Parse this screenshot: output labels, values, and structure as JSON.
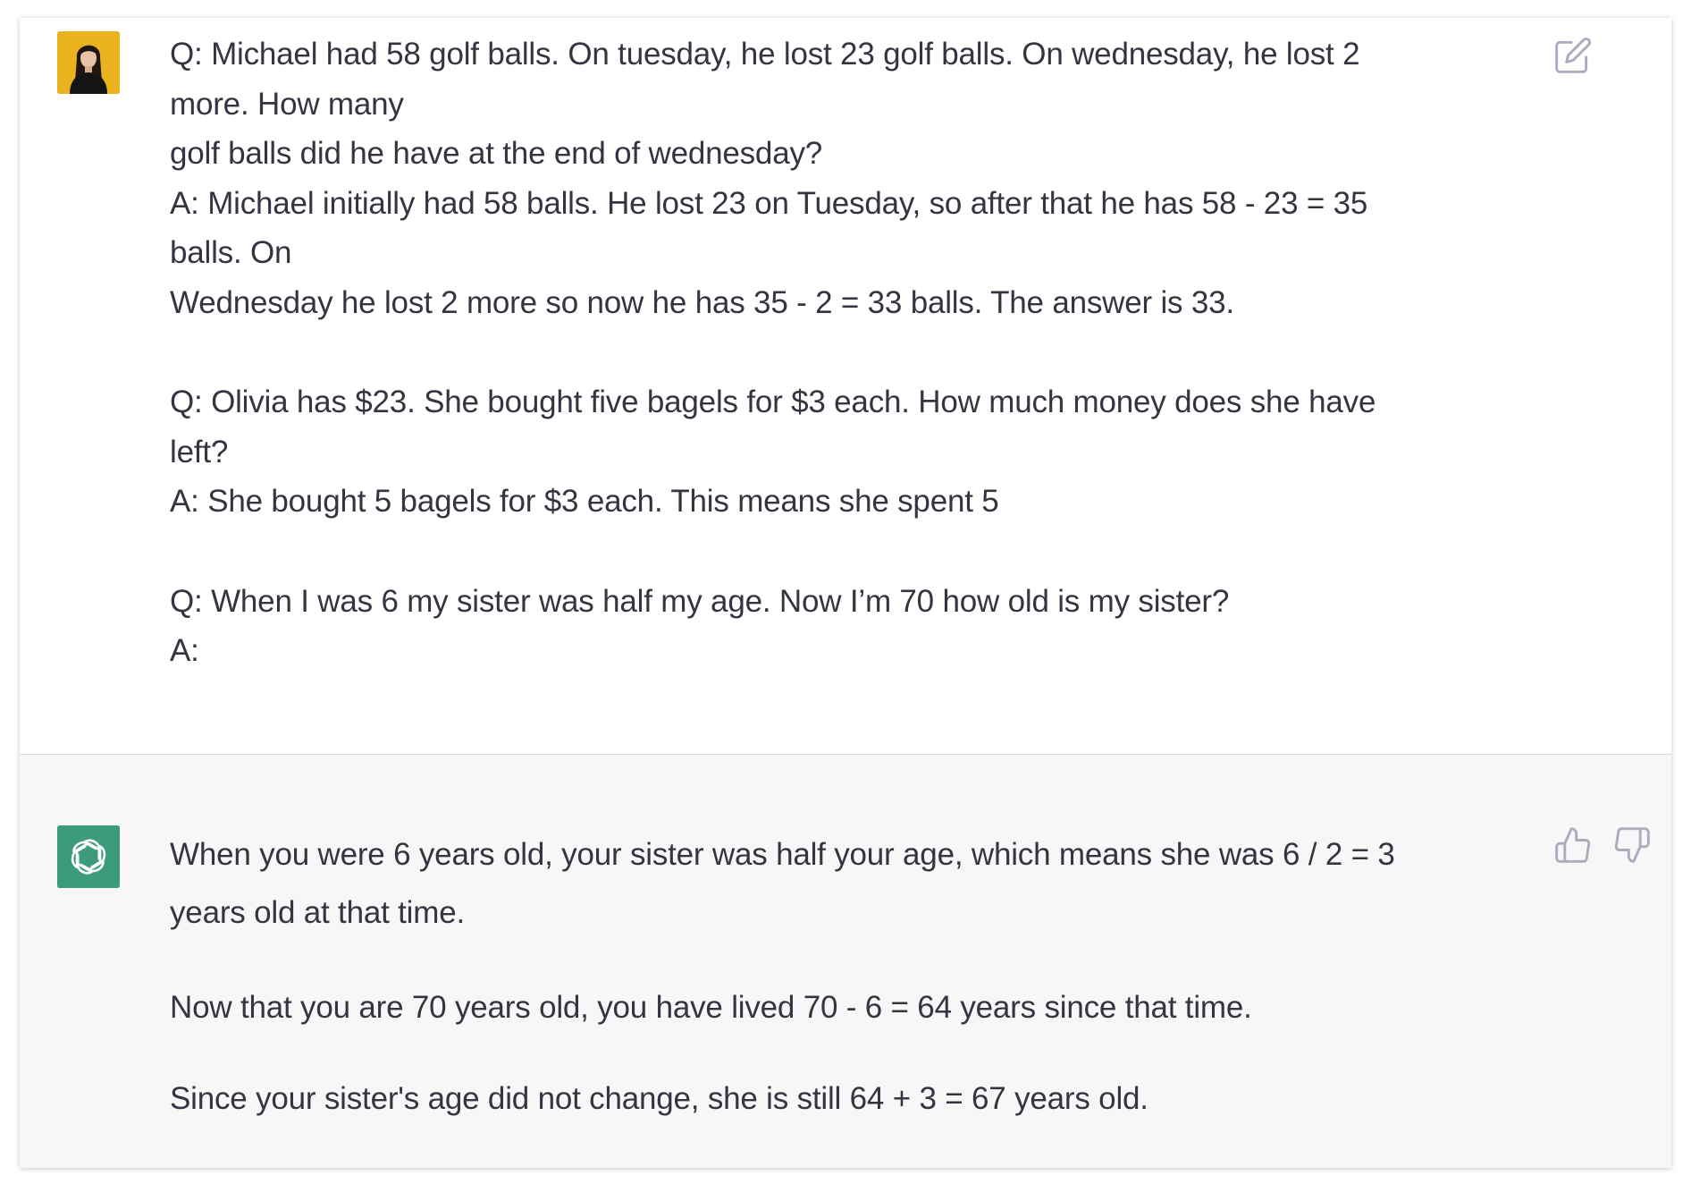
{
  "conversation": {
    "user_message": {
      "avatar_icon": "user-avatar-woman-icon",
      "lines": [
        "Q: Michael had 58 golf balls. On tuesday, he lost 23 golf balls. On wednesday, he lost 2",
        "more. How many",
        "golf balls did he have at the end of wednesday?",
        "A: Michael initially had 58 balls. He lost 23 on Tuesday, so after that he has 58 - 23 = 35",
        "balls. On",
        "Wednesday he lost 2 more so now he has 35 - 2 = 33 balls. The answer is 33.",
        "",
        "Q: Olivia has $23. She bought five bagels for $3 each. How much money does she have",
        "left?",
        "A: She bought 5 bagels for $3 each. This means she spent 5",
        "",
        "Q: When I was 6 my sister was half my age. Now I’m 70 how old is my sister?",
        "A:"
      ],
      "edit_icon": "edit-icon"
    },
    "assistant_message": {
      "avatar_icon": "openai-logo-icon",
      "paragraphs": [
        "When you were 6 years old, your sister was half your age, which means she was 6 / 2 = 3",
        "years old at that time.",
        "Now that you are 70 years old, you have lived 70 - 6 = 64 years since that time.",
        "Since your sister's age did not change, she is still 64 + 3 = 67 years old."
      ],
      "thumbs_up_icon": "thumbs-up-icon",
      "thumbs_down_icon": "thumbs-down-icon"
    }
  },
  "colors": {
    "text": "#343541",
    "assistant_bg": "#f7f7f8",
    "assistant_avatar": "#3b9b7c",
    "user_avatar": "#e9b21e",
    "icon_gray": "#acacbe"
  }
}
